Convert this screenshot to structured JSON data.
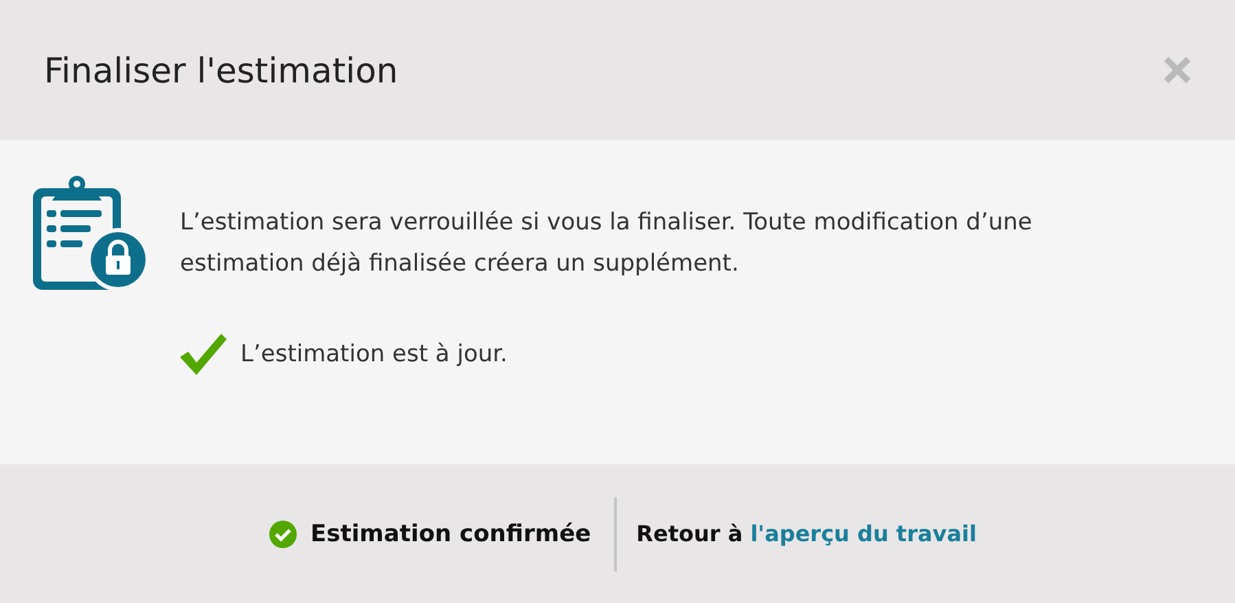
{
  "dialog": {
    "title": "Finaliser l'estimation"
  },
  "body": {
    "message": "L’estimation sera verrouillée si vous la finaliser. Toute modification d’une estimation déjà finalisée créera un supplément.",
    "status": "L’estimation est à jour."
  },
  "footer": {
    "confirmed": "Estimation confirmée",
    "back_prefix": "Retour à",
    "back_link": "l'aperçu du travail"
  }
}
